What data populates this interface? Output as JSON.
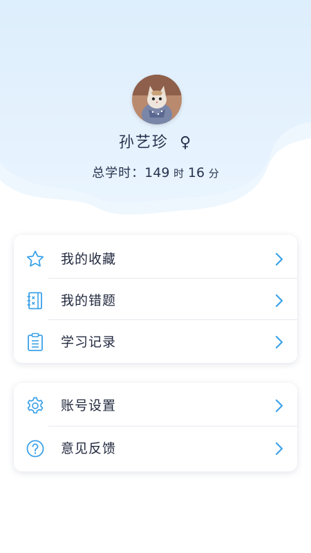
{
  "profile": {
    "name": "孙艺珍",
    "gender_symbol": "♀",
    "study_time_label": "总学时：",
    "hours": "149",
    "hours_unit": "时",
    "minutes": "16",
    "minutes_unit": "分"
  },
  "menu_primary": [
    {
      "label": "我的收藏",
      "icon": "star-icon"
    },
    {
      "label": "我的错题",
      "icon": "mistake-notebook-icon"
    },
    {
      "label": "学习记录",
      "icon": "clipboard-list-icon"
    }
  ],
  "menu_secondary": [
    {
      "label": "账号设置",
      "icon": "gear-icon"
    },
    {
      "label": "意见反馈",
      "icon": "question-circle-icon"
    }
  ],
  "colors": {
    "accent": "#3aa1e8",
    "hero_bg": "#e6f3fd",
    "hero_wave_light": "#eef7fe",
    "text_dark": "#27314e"
  }
}
